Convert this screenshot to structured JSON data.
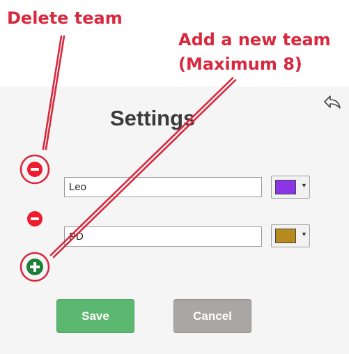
{
  "annotations": {
    "delete_team": "Delete team",
    "add_team_line1": "Add a new team",
    "add_team_line2": "(Maximum 8)"
  },
  "settings": {
    "title": "Settings",
    "back_icon": "back-arrow-icon",
    "teams": [
      {
        "name": "Leo",
        "color": "#8a36e6"
      },
      {
        "name": "PD",
        "color": "#b88b1e"
      }
    ],
    "save_label": "Save",
    "cancel_label": "Cancel"
  },
  "colors": {
    "annotation": "#d8283e",
    "remove": "#ee1b2c",
    "add": "#1d7f35",
    "save": "#5cb870",
    "cancel": "#aba6a6"
  }
}
